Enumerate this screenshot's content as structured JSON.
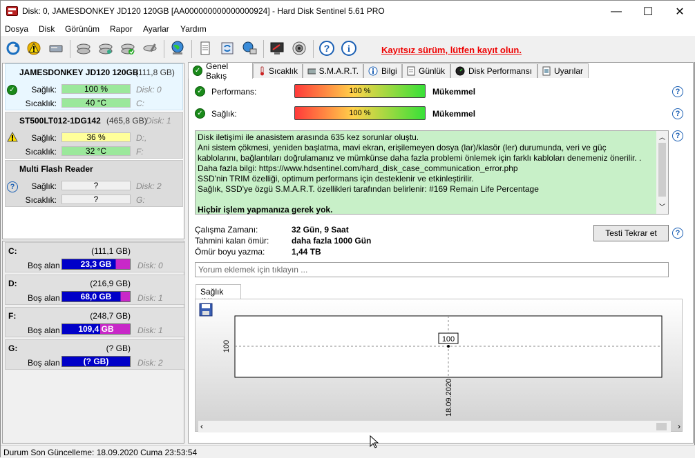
{
  "window": {
    "title": "Disk: 0, JAMESDONKEY JD120 120GB [AA000000000000000924]  -  Hard Disk Sentinel 5.61 PRO",
    "minimize": "—",
    "maximize": "☐",
    "close": "✕"
  },
  "menu": [
    "Dosya",
    "Disk",
    "Görünüm",
    "Rapor",
    "Ayarlar",
    "Yardım"
  ],
  "toolbar": {
    "unregistered_link": "Kayıtsız sürüm, lütfen kayıt olun."
  },
  "disks": [
    {
      "name": "JAMESDONKEY JD120 120GB",
      "size": "(111,8 GB)",
      "disk_label": "",
      "health_label": "Sağlık:",
      "health": "100 %",
      "health_disk": "Disk: 0",
      "temp_label": "Sıcaklık:",
      "temp": "40 °C",
      "temp_drive": "C:",
      "status": "ok"
    },
    {
      "name": "ST500LT012-1DG142",
      "size": "(465,8 GB)",
      "disk_label": "Disk: 1",
      "health_label": "Sağlık:",
      "health": "36 %",
      "health_disk": "D:,",
      "temp_label": "Sıcaklık:",
      "temp": "32 °C",
      "temp_drive": "F:",
      "status": "warning"
    },
    {
      "name": "Multi   Flash Reader",
      "size": "",
      "disk_label": "",
      "health_label": "Sağlık:",
      "health": "?",
      "health_disk": "Disk: 2",
      "temp_label": "Sıcaklık:",
      "temp": "?",
      "temp_drive": "G:",
      "status": "unknown"
    }
  ],
  "volumes": [
    {
      "letter": "C:",
      "size": "(111,1 GB)",
      "free_label": "Boş alan",
      "free": "23,3 GB",
      "free_fraction": 0.79,
      "disk": "Disk: 0"
    },
    {
      "letter": "D:",
      "size": "(216,9 GB)",
      "free_label": "Boş alan",
      "free": "68,0 GB",
      "free_fraction": 0.86,
      "disk": "Disk: 1"
    },
    {
      "letter": "F:",
      "size": "(248,7 GB)",
      "free_label": "Boş alan",
      "free": "109,4 GB",
      "free_fraction": 0.56,
      "disk": "Disk: 1"
    },
    {
      "letter": "G:",
      "size": "(? GB)",
      "free_label": "Boş alan",
      "free": "(? GB)",
      "free_fraction": 1.0,
      "disk": "Disk: 2"
    }
  ],
  "tabs": [
    "Genel Bakış",
    "Sıcaklık",
    "S.M.A.R.T.",
    "Bilgi",
    "Günlük",
    "Disk Performansı",
    "Uyarılar"
  ],
  "overview": {
    "performance_label": "Performans:",
    "performance_value": "100 %",
    "performance_text": "Mükemmel",
    "health_label": "Sağlık:",
    "health_value": "100 %",
    "health_text": "Mükemmel",
    "message_lines": [
      "Disk iletişimi ile anasistem arasında 635 kez sorunlar oluştu.",
      "Ani sistem çökmesi, yeniden başlatma, mavi ekran, erişilemeyen dosya (lar)/klasör (ler) durumunda, veri ve güç",
      "kablolarını, bağlantıları doğrulamanız ve mümkünse daha fazla problemi önlemek için farklı kabloları denemeniz önerilir. .",
      "Daha fazla bilgi: https://www.hdsentinel.com/hard_disk_case_communication_error.php",
      "SSD'nin TRIM özelliği, optimum performans için desteklenir ve etkinleştirilir.",
      "Sağlık, SSD'ye özgü S.M.A.R.T. özellikleri tarafından belirlenir: #169 Remain Life Percentage"
    ],
    "message_bold": "Hiçbir işlem yapmanıza gerek yok.",
    "uptime_label": "Çalışma Zamanı:",
    "uptime_value": "32 Gün, 9 Saat",
    "remaining_label": "Tahmini kalan ömür:",
    "remaining_value": "daha fazla 1000 Gün",
    "written_label": "Ömür boyu yazma:",
    "written_value": "1,44 TB",
    "retest_button": "Testi Tekrar et",
    "comment_placeholder": "Yorum eklemek için tıklayın ..."
  },
  "chart_tab": "Sağlık (%)",
  "chart_data": {
    "type": "line",
    "x": [
      "18.09.2020"
    ],
    "series": [
      {
        "values": [
          100
        ]
      }
    ],
    "ytick": "100",
    "data_label": "100"
  },
  "statusbar": {
    "text": "Durum Son Güncelleme: 18.09.2020 Cuma 23:53:54"
  }
}
